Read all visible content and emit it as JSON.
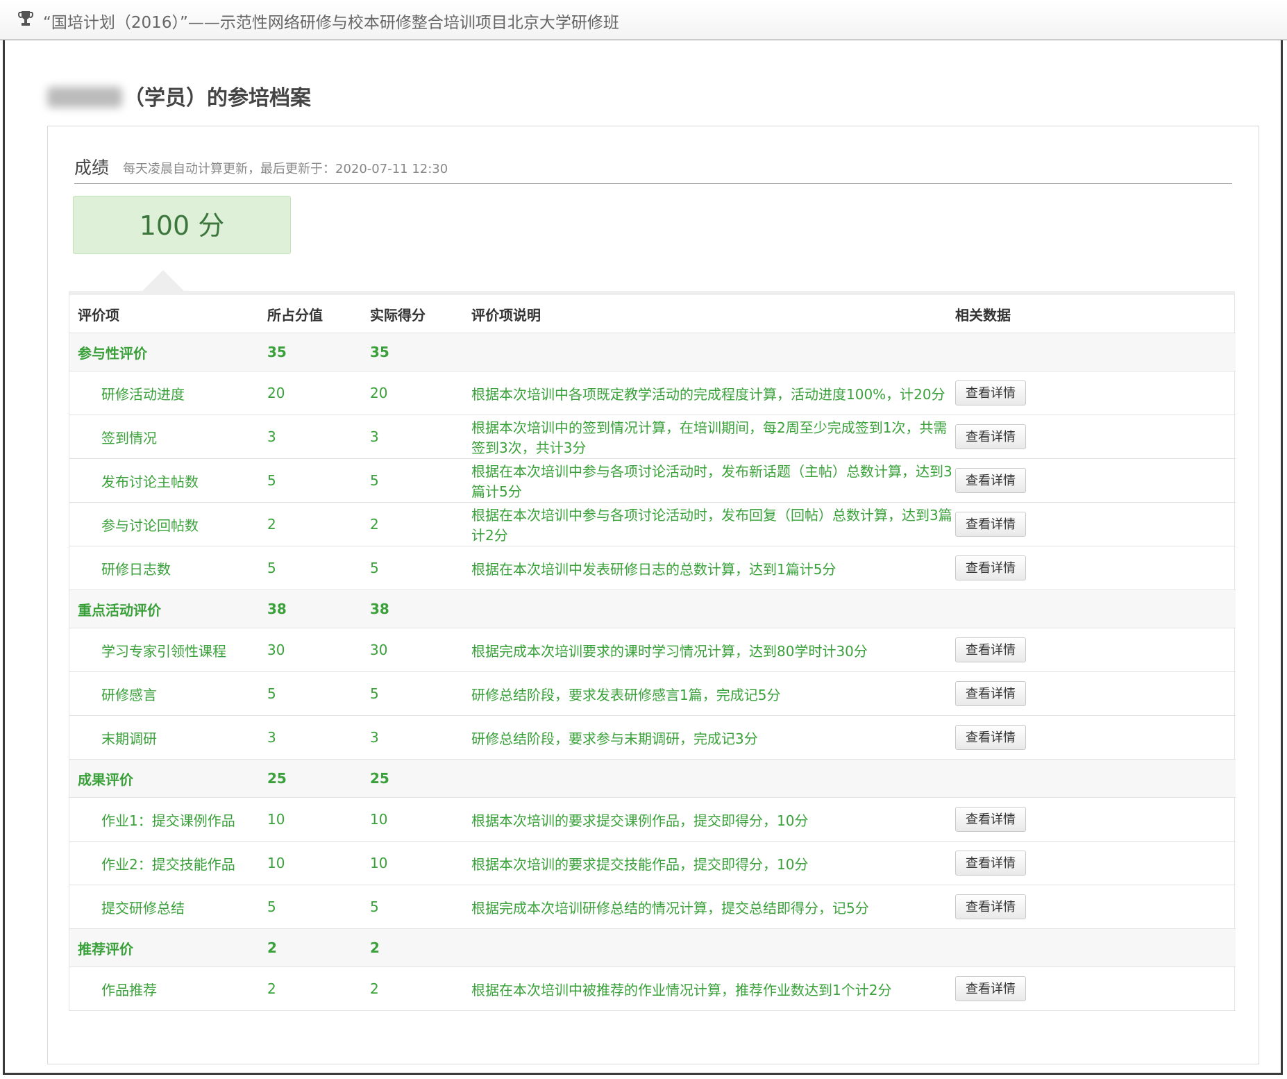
{
  "header": {
    "title": "“国培计划（2016）”——示范性网络研修与校本研修整合培训项目北京大学研修班",
    "icon": "trophy-icon"
  },
  "profile": {
    "title_suffix": "（学员）的参培档案"
  },
  "score": {
    "label": "成绩",
    "update_note": "每天凌晨自动计算更新，最后更新于：2020-07-11 12:30",
    "total": "100 分"
  },
  "table": {
    "columns": [
      "评价项",
      "所占分值",
      "实际得分",
      "评价项说明",
      "相关数据"
    ],
    "button_label": "查看详情",
    "groups": [
      {
        "name": "参与性评价",
        "weight": "35",
        "actual": "35",
        "items": [
          {
            "name": "研修活动进度",
            "weight": "20",
            "actual": "20",
            "desc": "根据本次培训中各项既定教学活动的完成程度计算，活动进度100%，计20分"
          },
          {
            "name": "签到情况",
            "weight": "3",
            "actual": "3",
            "desc": "根据本次培训中的签到情况计算，在培训期间，每2周至少完成签到1次，共需签到3次，共计3分"
          },
          {
            "name": "发布讨论主帖数",
            "weight": "5",
            "actual": "5",
            "desc": "根据在本次培训中参与各项讨论活动时，发布新话题（主帖）总数计算，达到3篇计5分"
          },
          {
            "name": "参与讨论回帖数",
            "weight": "2",
            "actual": "2",
            "desc": "根据在本次培训中参与各项讨论活动时，发布回复（回帖）总数计算，达到3篇计2分"
          },
          {
            "name": "研修日志数",
            "weight": "5",
            "actual": "5",
            "desc": "根据在本次培训中发表研修日志的总数计算，达到1篇计5分"
          }
        ]
      },
      {
        "name": "重点活动评价",
        "weight": "38",
        "actual": "38",
        "items": [
          {
            "name": "学习专家引领性课程",
            "weight": "30",
            "actual": "30",
            "desc": "根据完成本次培训要求的课时学习情况计算，达到80学时计30分"
          },
          {
            "name": "研修感言",
            "weight": "5",
            "actual": "5",
            "desc": "研修总结阶段，要求发表研修感言1篇，完成记5分"
          },
          {
            "name": "末期调研",
            "weight": "3",
            "actual": "3",
            "desc": "研修总结阶段，要求参与末期调研，完成记3分"
          }
        ]
      },
      {
        "name": "成果评价",
        "weight": "25",
        "actual": "25",
        "items": [
          {
            "name": "作业1：提交课例作品",
            "weight": "10",
            "actual": "10",
            "desc": "根据本次培训的要求提交课例作品，提交即得分，10分"
          },
          {
            "name": "作业2：提交技能作品",
            "weight": "10",
            "actual": "10",
            "desc": "根据本次培训的要求提交技能作品，提交即得分，10分"
          },
          {
            "name": "提交研修总结",
            "weight": "5",
            "actual": "5",
            "desc": "根据完成本次培训研修总结的情况计算，提交总结即得分，记5分"
          }
        ]
      },
      {
        "name": "推荐评价",
        "weight": "2",
        "actual": "2",
        "items": [
          {
            "name": "作品推荐",
            "weight": "2",
            "actual": "2",
            "desc": "根据在本次培训中被推荐的作业情况计算，推荐作业数达到1个计2分"
          }
        ]
      }
    ]
  },
  "colors": {
    "green_text": "#3aa13a",
    "score_bg": "#dff0d8",
    "score_text": "#3c763d"
  }
}
